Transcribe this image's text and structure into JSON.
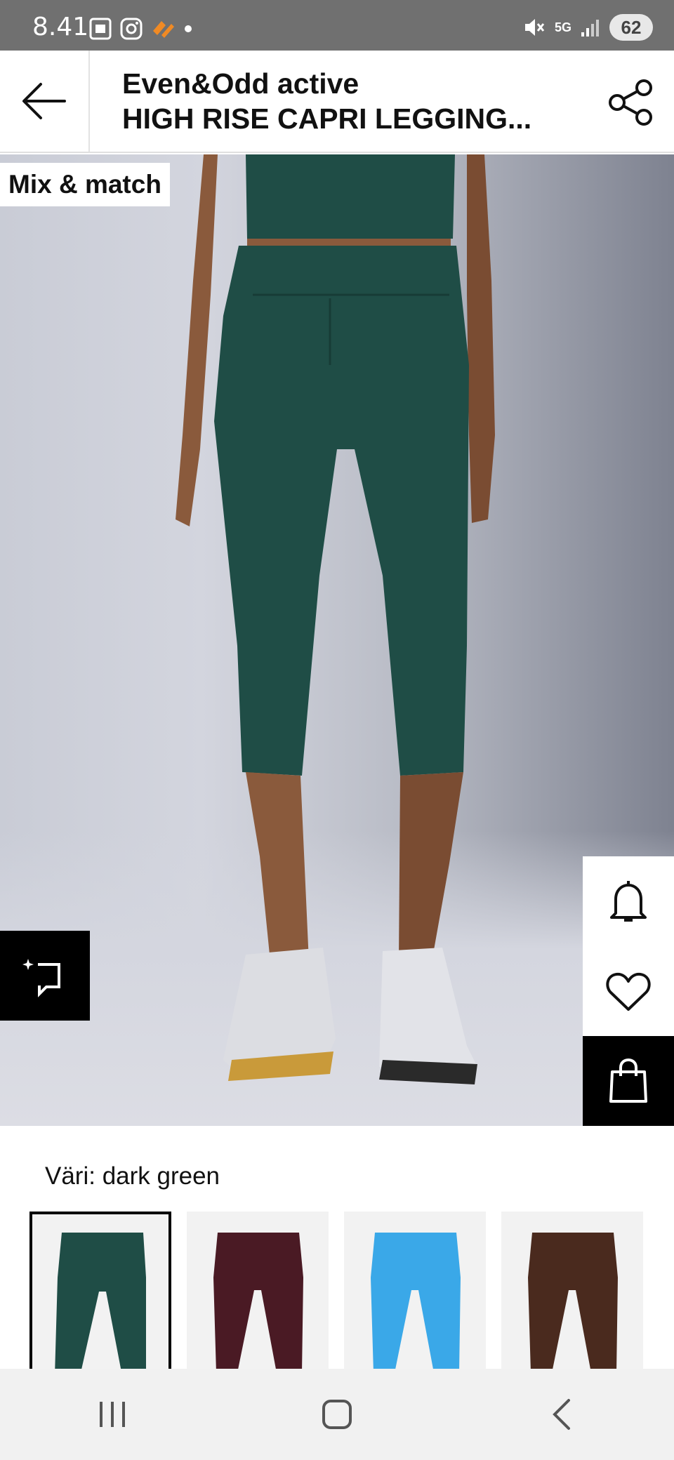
{
  "status_bar": {
    "time": "8.41",
    "network": "5G",
    "battery": "62"
  },
  "header": {
    "brand": "Even&Odd active",
    "product_name": "HIGH RISE CAPRI LEGGING..."
  },
  "hero": {
    "badge": "Mix & match",
    "image_description_icon": "product-photo"
  },
  "colors": {
    "accent": "#000000",
    "legging_dark_green": "#1f4d46",
    "swatch_burgundy": "#4a1a24",
    "swatch_blue": "#3aa8e8",
    "swatch_brown": "#4a2a1e",
    "background_photo": "#c9ccd6"
  },
  "color_section": {
    "label": "Väri: dark green",
    "swatches": [
      {
        "name": "dark green",
        "color": "#1f4d46",
        "selected": true
      },
      {
        "name": "burgundy",
        "color": "#4a1a24",
        "selected": false
      },
      {
        "name": "blue",
        "color": "#3aa8e8",
        "selected": false
      },
      {
        "name": "brown",
        "color": "#4a2a1e",
        "selected": false
      }
    ]
  },
  "gallery": {
    "current_page": 1
  }
}
